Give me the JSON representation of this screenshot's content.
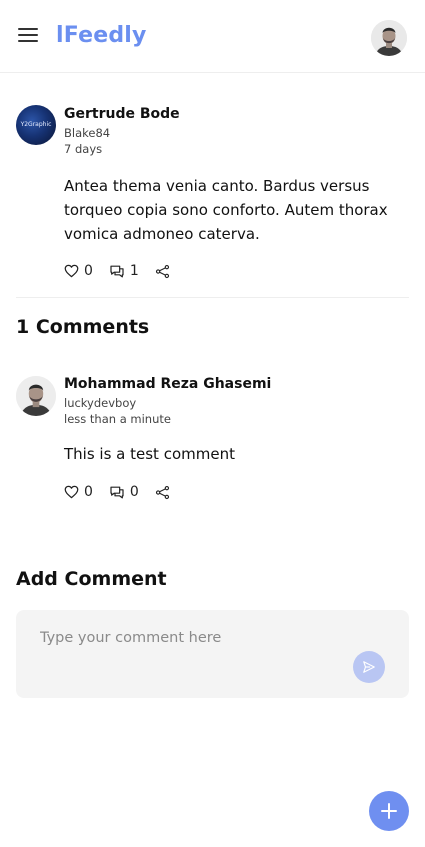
{
  "app": {
    "brand": "lFeedly"
  },
  "post": {
    "avatar_text": "Y2Graphic",
    "author_name": "Gertrude Bode",
    "username": "Blake84",
    "time": "7 days",
    "body": "Antea thema venia canto. Bardus versus torqueo copia sono conforto. Autem thorax vomica admoneo caterva.",
    "likes": "0",
    "comments": "1"
  },
  "comments_section": {
    "title": "1 Comments",
    "items": [
      {
        "author_name": "Mohammad Reza Ghasemi",
        "username": "luckydevboy",
        "time": "less than a minute",
        "body": "This is a test comment",
        "likes": "0",
        "comments": "0"
      }
    ]
  },
  "add_comment": {
    "title": "Add Comment",
    "placeholder": "Type your comment here"
  },
  "colors": {
    "accent": "#6b8ff0",
    "send_button": "#b9c6f3",
    "input_background": "#f4f4f4"
  },
  "icons": [
    "menu-icon",
    "heart-icon",
    "comment-icon",
    "share-icon",
    "send-icon",
    "plus-icon"
  ]
}
